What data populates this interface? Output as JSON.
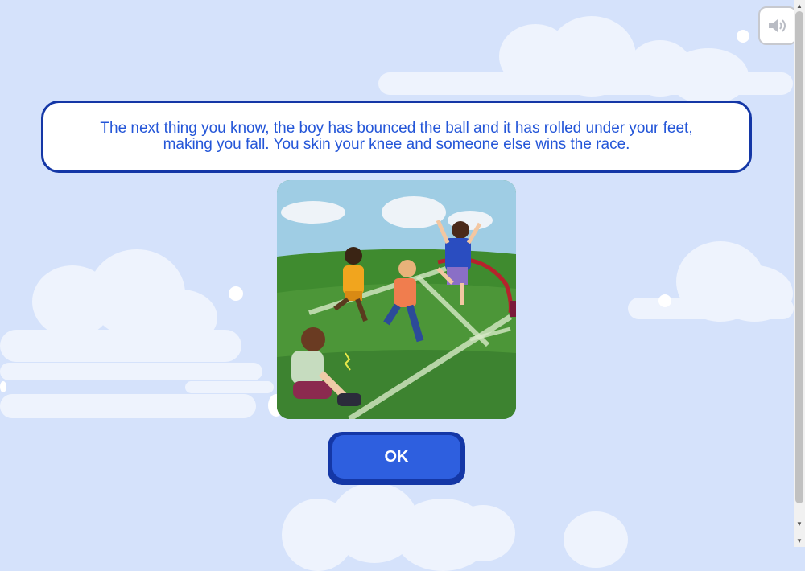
{
  "message": {
    "text": "The next thing you know, the boy has bounced the ball and it has rolled under your feet, making you fall. You skin your knee and someone else wins the race."
  },
  "illustration": {
    "description_icon": "children-race-illustration"
  },
  "buttons": {
    "ok_label": "OK",
    "sound_icon": "speaker-icon"
  },
  "colors": {
    "background": "#d5e2fb",
    "accent": "#2e5fdf",
    "border": "#1437a6",
    "text": "#2456d8"
  }
}
